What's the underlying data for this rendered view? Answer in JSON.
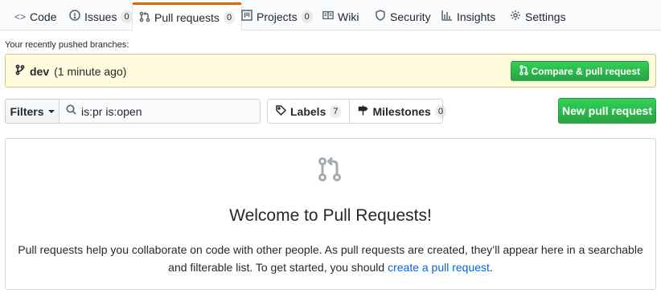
{
  "tabs": [
    {
      "label": "Code",
      "icon": "code-icon"
    },
    {
      "label": "Issues",
      "icon": "issue-icon",
      "count": "0"
    },
    {
      "label": "Pull requests",
      "icon": "pull-request-icon",
      "count": "0",
      "selected": true
    },
    {
      "label": "Projects",
      "icon": "project-icon",
      "count": "0"
    },
    {
      "label": "Wiki",
      "icon": "book-icon"
    },
    {
      "label": "Security",
      "icon": "shield-icon"
    },
    {
      "label": "Insights",
      "icon": "graph-icon"
    },
    {
      "label": "Settings",
      "icon": "gear-icon"
    }
  ],
  "recent": {
    "label": "Your recently pushed branches:",
    "branch": "dev",
    "age": "(1 minute ago)",
    "compare_label": "Compare & pull request"
  },
  "filters": {
    "button_label": "Filters",
    "search_value": "is:pr is:open",
    "labels_label": "Labels",
    "labels_count": "7",
    "milestones_label": "Milestones",
    "milestones_count": "0",
    "new_pr_label": "New pull request"
  },
  "blankslate": {
    "icon": "pull-request-icon",
    "title": "Welcome to Pull Requests!",
    "text_before": "Pull requests help you collaborate on code with other people. As pull requests are created, they’ll appear here in a searchable and filterable list. To get started, you should ",
    "link_text": "create a pull request",
    "text_after": "."
  },
  "colors": {
    "accent_tab": "#e36209",
    "primary_green": "#28a745",
    "flash_bg": "#fffbdd",
    "link": "#0366d6"
  }
}
